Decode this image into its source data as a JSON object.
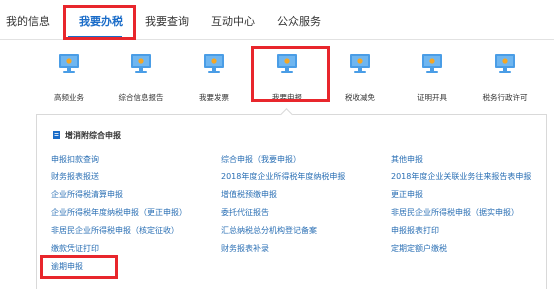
{
  "tabs": [
    {
      "label": "我的信息",
      "active": false
    },
    {
      "label": "我要办税",
      "active": true
    },
    {
      "label": "我要查询",
      "active": false
    },
    {
      "label": "互动中心",
      "active": false
    },
    {
      "label": "公众服务",
      "active": false
    }
  ],
  "services": [
    {
      "label": "高频业务",
      "icon": "monitor-icon"
    },
    {
      "label": "综合信息报告",
      "icon": "monitor-icon"
    },
    {
      "label": "我要发票",
      "icon": "monitor-icon"
    },
    {
      "label": "我要申报",
      "icon": "monitor-icon"
    },
    {
      "label": "税收减免",
      "icon": "monitor-icon"
    },
    {
      "label": "证明开具",
      "icon": "monitor-icon"
    },
    {
      "label": "税务行政许可",
      "icon": "monitor-icon"
    }
  ],
  "panel": {
    "heading": "增消附综合申报",
    "links": [
      [
        "申报扣款查询",
        "综合申报（我要申报）",
        "其他申报"
      ],
      [
        "财务报表报送",
        "2018年度企业所得税年度纳税申报",
        "2018年度企业关联业务往来报告表申报"
      ],
      [
        "企业所得税清算申报",
        "增值税预缴申报",
        "更正申报"
      ],
      [
        "企业所得税年度纳税申报（更正申报）",
        "委托代征报告",
        "非居民企业所得税申报（据实申报）"
      ],
      [
        "非居民企业所得税申报（核定征收）",
        "汇总纳税总分机构登记备案",
        "申报报表打印"
      ],
      [
        "缴款凭证打印",
        "财务报表补录",
        "定期定额户缴税"
      ],
      [
        "逾期申报",
        "",
        ""
      ]
    ]
  },
  "colors": {
    "accent": "#1a6cc8",
    "link": "#2a6fb4",
    "highlight": "#e8262c",
    "icon_blue": "#4a9de6",
    "icon_sun": "#f5a623"
  }
}
